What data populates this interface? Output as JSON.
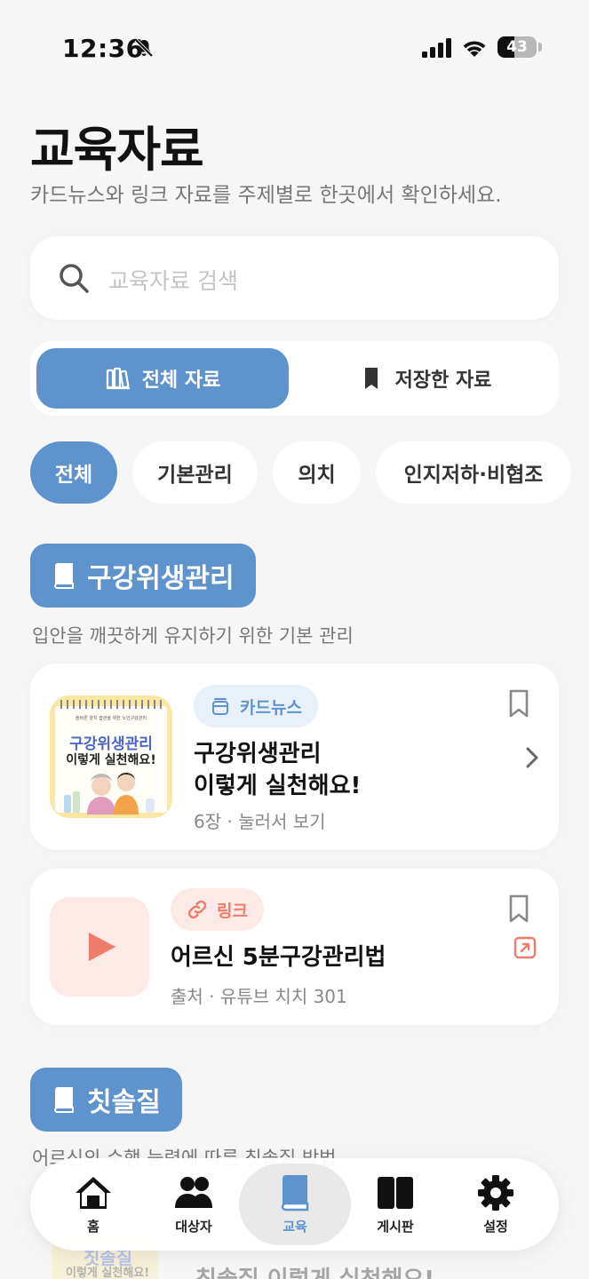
{
  "status": {
    "time": "12:36",
    "battery": "43",
    "battery_level": 0.43
  },
  "header": {
    "title": "교육자료",
    "subtitle": "카드뉴스와 링크 자료를 주제별로 한곳에서 확인하세요."
  },
  "search": {
    "placeholder": "교육자료 검색"
  },
  "segment": {
    "all_label": "전체 자료",
    "saved_label": "저장한 자료"
  },
  "chips": [
    "전체",
    "기본관리",
    "의치",
    "인지저하·비협조"
  ],
  "sections": [
    {
      "title": "구강위생관리",
      "desc": "입안을 깨끗하게 유지하기 위한 기본 관리",
      "items": [
        {
          "type_label": "카드뉴스",
          "name_line1": "구강위생관리",
          "name_line2": "이렇게 실천해요!",
          "meta": "6장 · 눌러서 보기",
          "thumb_top": "올바른 양치 습관을 위한 노인구강관리",
          "thumb_line1": "구강위생관리",
          "thumb_line2": "이렇게 실천해요!"
        },
        {
          "type_label": "링크",
          "name": "어르신 5분구강관리법",
          "meta": "출처 · 유튜브 치치 301"
        }
      ]
    },
    {
      "title": "칫솔질",
      "desc": "어르신의 수행 능력에 따른 칫솔질 방법",
      "peek_thumb_1": "칫솔질",
      "peek_thumb_2": "이렇게 실천해요!",
      "peek_name": "칫솔질 이렇게 실천해요!"
    }
  ],
  "tabbar": {
    "tabs": [
      {
        "label": "홈",
        "icon": "home-icon"
      },
      {
        "label": "대상자",
        "icon": "people-icon"
      },
      {
        "label": "교육",
        "icon": "book-icon",
        "active": true
      },
      {
        "label": "게시판",
        "icon": "board-icon"
      },
      {
        "label": "설정",
        "icon": "gear-icon"
      }
    ]
  },
  "colors": {
    "accent": "#5f93cd",
    "link": "#ee7c6b",
    "background": "#f6f6f6"
  }
}
